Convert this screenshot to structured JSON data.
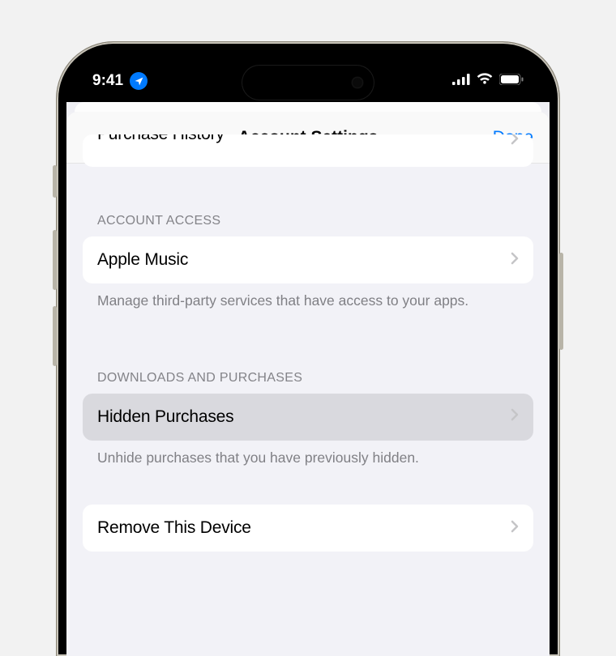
{
  "status_bar": {
    "time": "9:41"
  },
  "sheet": {
    "title": "Account Settings",
    "done_label": "Done"
  },
  "clipped_row": {
    "label": "Purchase History"
  },
  "sections": {
    "account_access": {
      "header": "ACCOUNT ACCESS",
      "row_label": "Apple Music",
      "footer": "Manage third-party services that have access to your apps."
    },
    "downloads": {
      "header": "DOWNLOADS AND PURCHASES",
      "row_label": "Hidden Purchases",
      "footer": "Unhide purchases that you have previously hidden."
    },
    "remove": {
      "row_label": "Remove This Device"
    }
  }
}
